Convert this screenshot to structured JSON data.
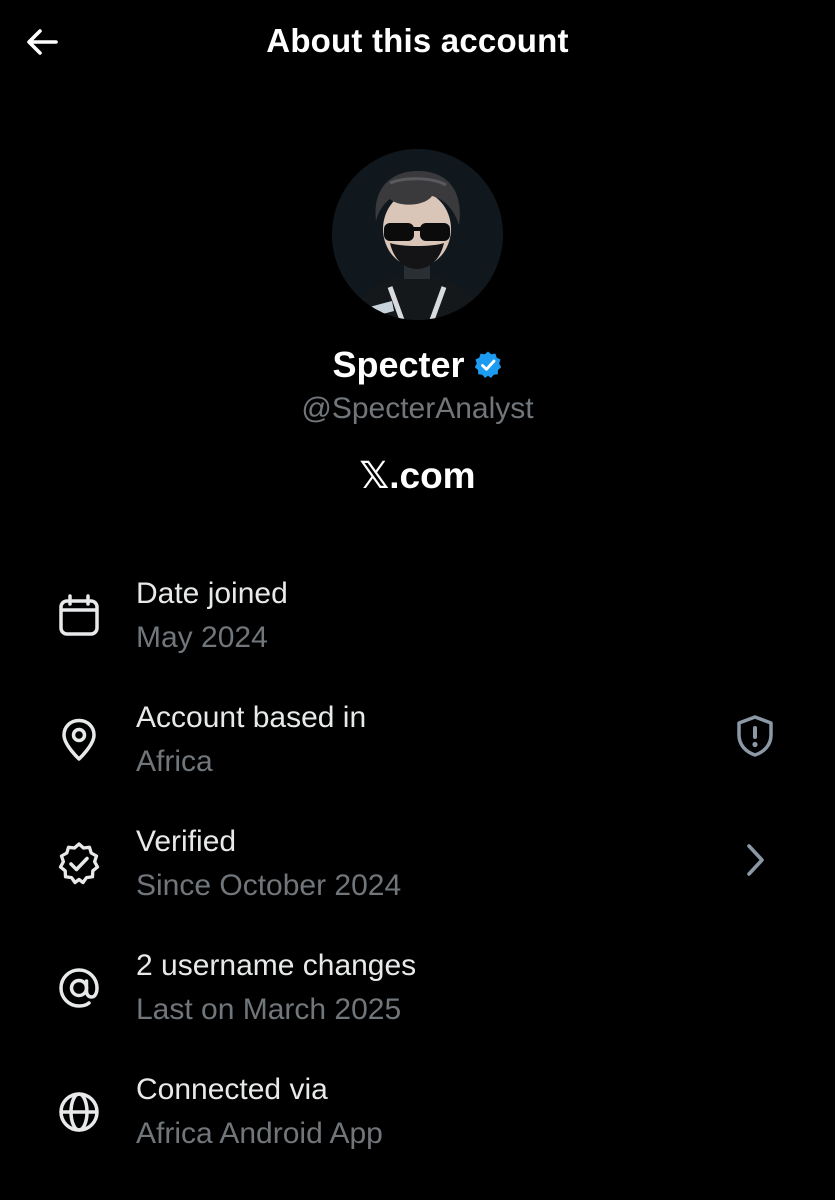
{
  "header": {
    "title": "About this account",
    "back_icon": "arrow-left-icon"
  },
  "profile": {
    "display_name": "Specter",
    "handle": "@SpecterAnalyst",
    "platform": "𝕏.com",
    "verified": true,
    "verified_badge_color": "#1d9bf0"
  },
  "items": [
    {
      "icon": "calendar-icon",
      "title": "Date joined",
      "subtitle": "May 2024"
    },
    {
      "icon": "location-pin-icon",
      "title": "Account based in",
      "subtitle": "Africa",
      "trailing_icon": "shield-alert-icon"
    },
    {
      "icon": "verified-check-icon",
      "title": "Verified",
      "subtitle": "Since October 2024",
      "trailing_icon": "chevron-right-icon"
    },
    {
      "icon": "at-sign-icon",
      "title": "2 username changes",
      "subtitle": "Last on March 2025"
    },
    {
      "icon": "globe-icon",
      "title": "Connected via",
      "subtitle": "Africa Android App"
    }
  ],
  "colors": {
    "background": "#000000",
    "primary_text": "#e7e9ea",
    "secondary_text": "#71767b",
    "accent": "#1d9bf0"
  }
}
